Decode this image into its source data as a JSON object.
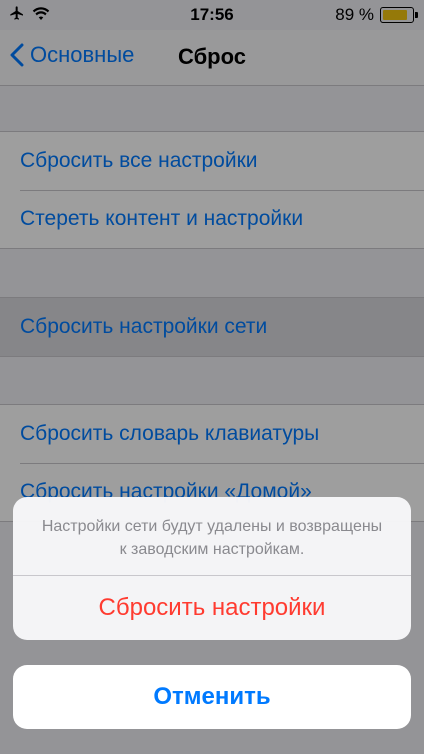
{
  "status_bar": {
    "time": "17:56",
    "battery_percent": "89 %",
    "battery_level": 0.89,
    "battery_color": "#f1c40f"
  },
  "nav": {
    "back_label": "Основные",
    "title": "Сброс"
  },
  "groups": [
    {
      "items": [
        {
          "label": "Сбросить все настройки"
        },
        {
          "label": "Стереть контент и настройки"
        }
      ]
    },
    {
      "items": [
        {
          "label": "Сбросить настройки сети"
        }
      ]
    },
    {
      "items": [
        {
          "label": "Сбросить словарь клавиатуры"
        },
        {
          "label": "Сбросить настройки «Домой»"
        }
      ]
    }
  ],
  "action_sheet": {
    "message": "Настройки сети будут удалены и возвращены к заводским настройкам.",
    "destructive_label": "Сбросить настройки",
    "cancel_label": "Отменить"
  },
  "colors": {
    "accent": "#007aff",
    "destructive": "#ff3b30"
  }
}
